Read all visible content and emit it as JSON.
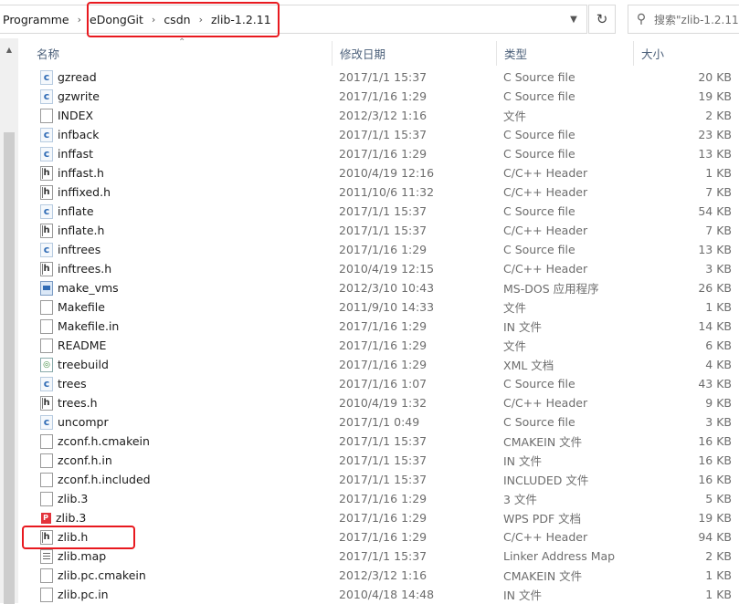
{
  "address": {
    "crumbs": [
      "Programme",
      "eDongGit",
      "csdn",
      "zlib-1.2.11"
    ]
  },
  "search": {
    "placeholder": "搜索\"zlib-1.2.11\""
  },
  "columns": {
    "name": "名称",
    "date": "修改日期",
    "type": "类型",
    "size": "大小"
  },
  "files": [
    {
      "name": "gzread",
      "date": "2017/1/1 15:37",
      "type": "C Source file",
      "size": "20 KB",
      "icon": "c-source-icon"
    },
    {
      "name": "gzwrite",
      "date": "2017/1/16 1:29",
      "type": "C Source file",
      "size": "19 KB",
      "icon": "c-source-icon"
    },
    {
      "name": "INDEX",
      "date": "2012/3/12 1:16",
      "type": "文件",
      "size": "2 KB",
      "icon": "generic-file-icon"
    },
    {
      "name": "infback",
      "date": "2017/1/1 15:37",
      "type": "C Source file",
      "size": "23 KB",
      "icon": "c-source-icon"
    },
    {
      "name": "inffast",
      "date": "2017/1/16 1:29",
      "type": "C Source file",
      "size": "13 KB",
      "icon": "c-source-icon"
    },
    {
      "name": "inffast.h",
      "date": "2010/4/19 12:16",
      "type": "C/C++ Header",
      "size": "1 KB",
      "icon": "c-header-icon"
    },
    {
      "name": "inffixed.h",
      "date": "2011/10/6 11:32",
      "type": "C/C++ Header",
      "size": "7 KB",
      "icon": "c-header-icon"
    },
    {
      "name": "inflate",
      "date": "2017/1/1 15:37",
      "type": "C Source file",
      "size": "54 KB",
      "icon": "c-source-icon"
    },
    {
      "name": "inflate.h",
      "date": "2017/1/1 15:37",
      "type": "C/C++ Header",
      "size": "7 KB",
      "icon": "c-header-icon"
    },
    {
      "name": "inftrees",
      "date": "2017/1/16 1:29",
      "type": "C Source file",
      "size": "13 KB",
      "icon": "c-source-icon"
    },
    {
      "name": "inftrees.h",
      "date": "2010/4/19 12:15",
      "type": "C/C++ Header",
      "size": "3 KB",
      "icon": "c-header-icon"
    },
    {
      "name": "make_vms",
      "date": "2012/3/10 10:43",
      "type": "MS-DOS 应用程序",
      "size": "26 KB",
      "icon": "executable-icon"
    },
    {
      "name": "Makefile",
      "date": "2011/9/10 14:33",
      "type": "文件",
      "size": "1 KB",
      "icon": "generic-file-icon"
    },
    {
      "name": "Makefile.in",
      "date": "2017/1/16 1:29",
      "type": "IN 文件",
      "size": "14 KB",
      "icon": "generic-file-icon"
    },
    {
      "name": "README",
      "date": "2017/1/16 1:29",
      "type": "文件",
      "size": "6 KB",
      "icon": "generic-file-icon"
    },
    {
      "name": "treebuild",
      "date": "2017/1/16 1:29",
      "type": "XML 文档",
      "size": "4 KB",
      "icon": "xml-file-icon"
    },
    {
      "name": "trees",
      "date": "2017/1/16 1:07",
      "type": "C Source file",
      "size": "43 KB",
      "icon": "c-source-icon"
    },
    {
      "name": "trees.h",
      "date": "2010/4/19 1:32",
      "type": "C/C++ Header",
      "size": "9 KB",
      "icon": "c-header-icon"
    },
    {
      "name": "uncompr",
      "date": "2017/1/1 0:49",
      "type": "C Source file",
      "size": "3 KB",
      "icon": "c-source-icon"
    },
    {
      "name": "zconf.h.cmakein",
      "date": "2017/1/1 15:37",
      "type": "CMAKEIN 文件",
      "size": "16 KB",
      "icon": "generic-file-icon"
    },
    {
      "name": "zconf.h.in",
      "date": "2017/1/1 15:37",
      "type": "IN 文件",
      "size": "16 KB",
      "icon": "generic-file-icon"
    },
    {
      "name": "zconf.h.included",
      "date": "2017/1/1 15:37",
      "type": "INCLUDED 文件",
      "size": "16 KB",
      "icon": "generic-file-icon"
    },
    {
      "name": "zlib.3",
      "date": "2017/1/16 1:29",
      "type": "3 文件",
      "size": "5 KB",
      "icon": "generic-file-icon"
    },
    {
      "name": "zlib.3",
      "date": "2017/1/16 1:29",
      "type": "WPS PDF 文档",
      "size": "19 KB",
      "icon": "pdf-file-icon"
    },
    {
      "name": "zlib.h",
      "date": "2017/1/16 1:29",
      "type": "C/C++ Header",
      "size": "94 KB",
      "icon": "c-header-icon"
    },
    {
      "name": "zlib.map",
      "date": "2017/1/1 15:37",
      "type": "Linker Address Map",
      "size": "2 KB",
      "icon": "map-file-icon"
    },
    {
      "name": "zlib.pc.cmakein",
      "date": "2012/3/12 1:16",
      "type": "CMAKEIN 文件",
      "size": "1 KB",
      "icon": "generic-file-icon"
    },
    {
      "name": "zlib.pc.in",
      "date": "2010/4/18 14:48",
      "type": "IN 文件",
      "size": "1 KB",
      "icon": "generic-file-icon"
    }
  ],
  "colors": {
    "highlight": "#e8191f",
    "header_text": "#4c607a"
  }
}
